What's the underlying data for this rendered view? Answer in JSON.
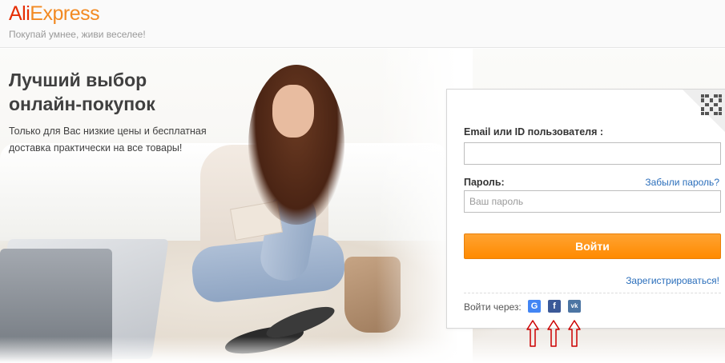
{
  "header": {
    "logo_part1": "Ali",
    "logo_part2": "Express",
    "tagline": "Покупай умнее, живи веселее!"
  },
  "hero": {
    "title_line1": "Лучший выбор",
    "title_line2": "онлайн-покупок",
    "subtitle_line1": "Только для Вас низкие цены и бесплатная",
    "subtitle_line2": "доставка практически на все товары!"
  },
  "login": {
    "email_label": "Email или ID пользователя :",
    "email_value": "",
    "password_label": "Пароль:",
    "forgot_link": "Забыли пароль?",
    "password_placeholder": "Ваш пароль",
    "submit_label": "Войти",
    "register_link": "Зарегистрироваться!",
    "social_label": "Войти через:",
    "social": [
      {
        "name": "google",
        "glyph": "G",
        "color": "#4285f4"
      },
      {
        "name": "facebook",
        "glyph": "f",
        "color": "#3b5998"
      },
      {
        "name": "vk",
        "glyph": "vk",
        "color": "#4c75a3"
      }
    ]
  },
  "colors": {
    "brand_red": "#e62e04",
    "brand_orange": "#f28a22",
    "button_orange": "#ff9a1f",
    "link_blue": "#2a6ebb",
    "annotation_arrow": "#cc0000"
  },
  "icons": [
    "qr-code-icon",
    "google-icon",
    "facebook-icon",
    "vk-icon",
    "up-arrow-icon"
  ]
}
